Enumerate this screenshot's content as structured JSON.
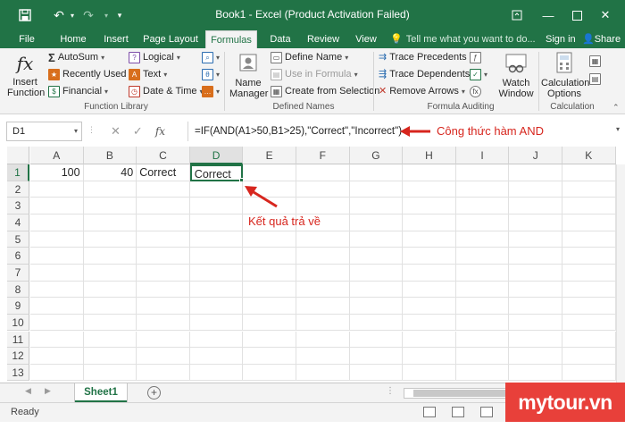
{
  "titlebar": {
    "title": "Book1 - Excel (Product Activation Failed)",
    "save_icon": "save-icon",
    "undo_icon": "undo-icon",
    "redo_icon": "redo-icon"
  },
  "tabs": [
    "File",
    "Home",
    "Insert",
    "Page Layout",
    "Formulas",
    "Data",
    "Review",
    "View"
  ],
  "active_tab": "Formulas",
  "tellme": "Tell me what you want to do...",
  "signin": "Sign in",
  "share": "Share",
  "ribbon": {
    "insert_function": "Insert\nFunction",
    "autosum": "AutoSum",
    "recently_used": "Recently Used",
    "financial": "Financial",
    "logical": "Logical",
    "text": "Text",
    "date_time": "Date & Time",
    "function_library_label": "Function Library",
    "name_manager": "Name\nManager",
    "define_name": "Define Name",
    "use_in_formula": "Use in Formula",
    "create_from_selection": "Create from Selection",
    "defined_names_label": "Defined Names",
    "trace_precedents": "Trace Precedents",
    "trace_dependents": "Trace Dependents",
    "remove_arrows": "Remove Arrows",
    "watch_window": "Watch\nWindow",
    "formula_auditing_label": "Formula Auditing",
    "calculation_options": "Calculation\nOptions",
    "calculation_label": "Calculation"
  },
  "formula_bar": {
    "name_box": "D1",
    "formula": "=IF(AND(A1>50,B1>25),\"Correct\",\"Incorrect\")"
  },
  "grid": {
    "columns": [
      "A",
      "B",
      "C",
      "D",
      "E",
      "F",
      "G",
      "H",
      "I",
      "J",
      "K"
    ],
    "rows": [
      "1",
      "2",
      "3",
      "4",
      "5",
      "6",
      "7",
      "8",
      "9",
      "10",
      "11",
      "12",
      "13"
    ],
    "cells": {
      "A1": "100",
      "B1": "40",
      "C1": "Correct",
      "D1": "Correct"
    },
    "active_cell": "D1"
  },
  "annotations": {
    "formula_note": "Công thức hàm AND",
    "result_note": "Kết quả trả về",
    "color": "#d7261e"
  },
  "sheets": [
    "Sheet1"
  ],
  "status": "Ready",
  "watermark": "mytour.vn",
  "colors": {
    "excel_green": "#217346",
    "watermark_red": "#e8403a"
  }
}
